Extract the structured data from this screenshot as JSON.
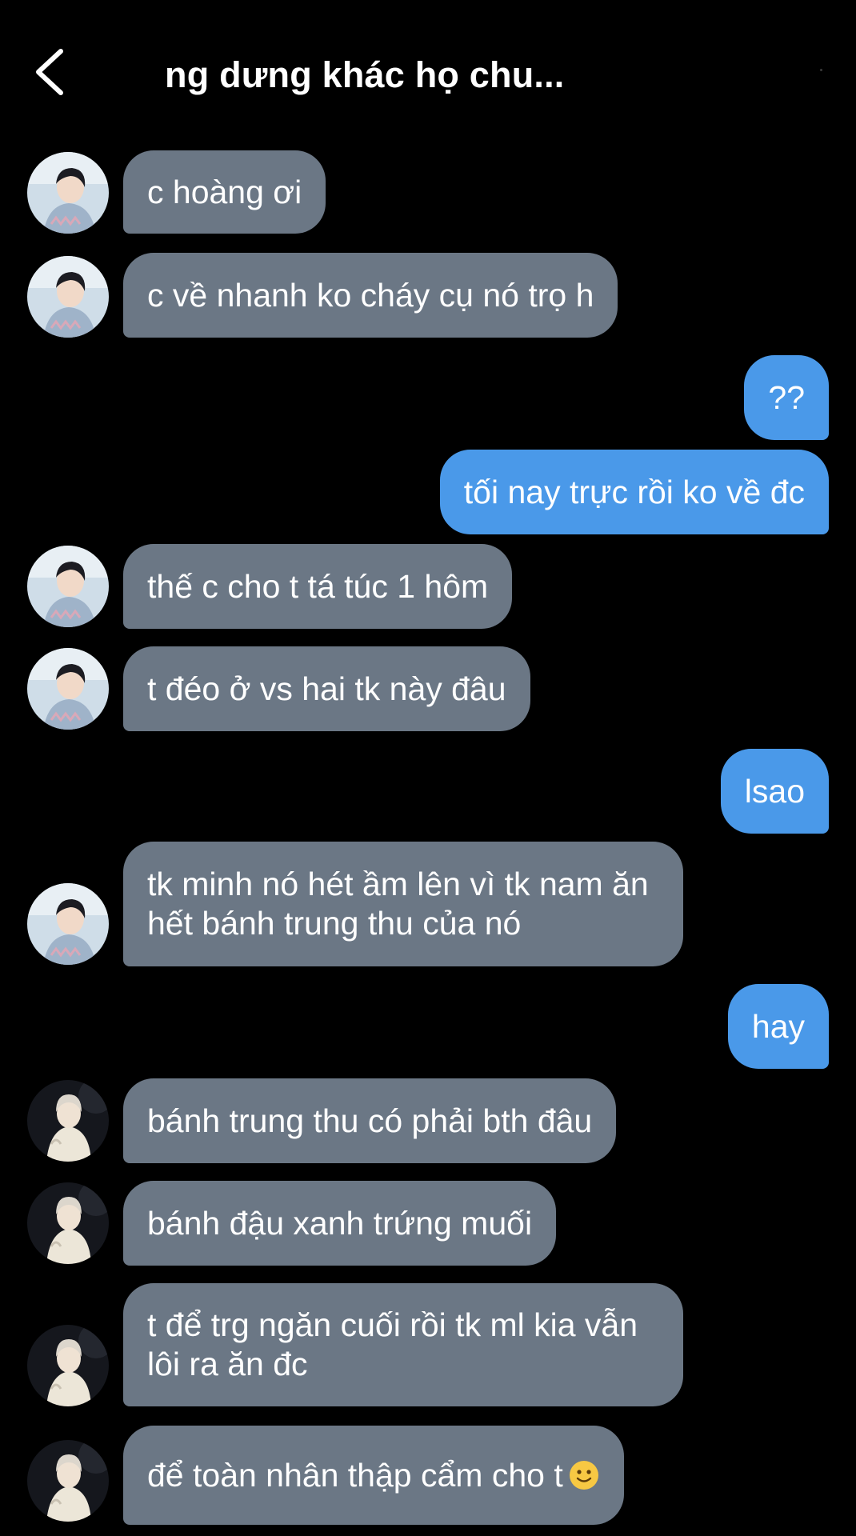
{
  "header": {
    "title": "ng dưng khác họ chu...",
    "back_icon": "chevron-left-icon"
  },
  "colors": {
    "background": "#000000",
    "incoming_bubble": "#6b7785",
    "outgoing_bubble": "#4a99e9"
  },
  "messages": [
    {
      "sender": "contact-a",
      "direction": "in",
      "text": "c hoàng ơi"
    },
    {
      "sender": "contact-a",
      "direction": "in",
      "text": "c về nhanh ko cháy cụ nó trọ h"
    },
    {
      "sender": "me",
      "direction": "out",
      "text": "??"
    },
    {
      "sender": "me",
      "direction": "out",
      "text": "tối nay trực rồi ko về đc"
    },
    {
      "sender": "contact-a",
      "direction": "in",
      "text": "thế c cho t tá túc 1 hôm"
    },
    {
      "sender": "contact-a",
      "direction": "in",
      "text": "t đéo ở vs hai tk này đâu"
    },
    {
      "sender": "me",
      "direction": "out",
      "text": "lsao"
    },
    {
      "sender": "contact-a",
      "direction": "in",
      "text": "tk minh nó hét ầm lên vì tk nam ăn hết bánh trung thu của nó"
    },
    {
      "sender": "me",
      "direction": "out",
      "text": "hay"
    },
    {
      "sender": "contact-b",
      "direction": "in",
      "text": "bánh trung thu có phải bth đâu"
    },
    {
      "sender": "contact-b",
      "direction": "in",
      "text": "bánh đậu xanh trứng muối"
    },
    {
      "sender": "contact-b",
      "direction": "in",
      "text": "t để trg ngăn cuối rồi tk ml kia vẫn lôi ra ăn đc"
    },
    {
      "sender": "contact-b",
      "direction": "in",
      "text": "để toàn nhân thập cẩm cho t",
      "emoji": "slightly-smiling-face-icon"
    }
  ]
}
